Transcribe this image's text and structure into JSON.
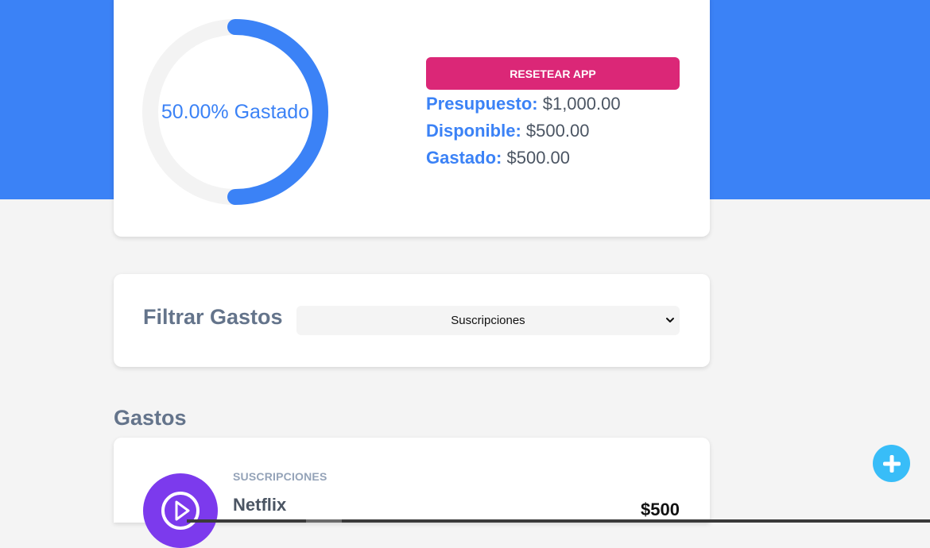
{
  "budget": {
    "percent_spent_value": 50,
    "percent_spent_text": "50.00% Gastado",
    "reset_label": "RESETEAR APP",
    "stats": [
      {
        "label": "Presupuesto:",
        "value": "$1,000.00"
      },
      {
        "label": "Disponible:",
        "value": "$500.00"
      },
      {
        "label": "Gastado:",
        "value": "$500.00"
      }
    ],
    "progress_color": "#3b82f6",
    "track_color": "#f3f3f3"
  },
  "filter": {
    "label": "Filtrar Gastos",
    "selected_option": "Suscripciones"
  },
  "expenses": {
    "title": "Gastos",
    "items": [
      {
        "category": "SUSCRIPCIONES",
        "name": "Netflix",
        "amount": "$500",
        "icon": "subscriptions-play-icon",
        "icon_color": "#7c3aed"
      }
    ]
  },
  "fab": {
    "icon": "plus-icon",
    "color": "#38bdf8"
  },
  "colors": {
    "hero": "#3b82f6",
    "reset": "#db2777",
    "background": "#f4f4f4"
  }
}
